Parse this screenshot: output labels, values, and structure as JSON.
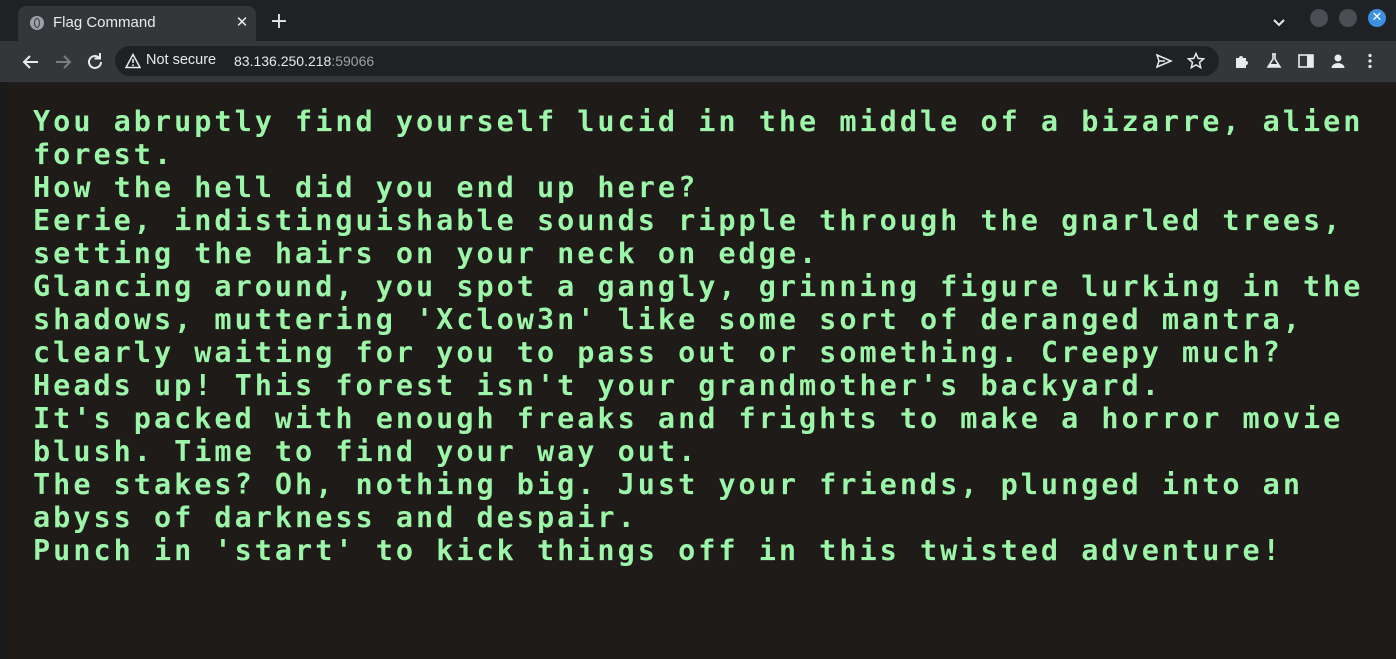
{
  "browser": {
    "tab": {
      "title": "Flag Command",
      "favicon": "globe-icon",
      "close_glyph": "✕"
    },
    "new_tab_glyph": "+",
    "window_close_glyph": "✕",
    "security_label": "Not secure",
    "url": {
      "host": "83.136.250.218",
      "port": ":59066"
    },
    "colors": {
      "tabstrip": "#202124",
      "toolbar": "#35363a",
      "page_background": "#1f1b19",
      "terminal_text": "#9cf5a8",
      "window_close": "#3d8fe0"
    }
  },
  "terminal": {
    "lines": [
      "You abruptly find yourself lucid in the middle of a bizarre, alien",
      "forest.",
      "How the hell did you end up here?",
      "Eerie, indistinguishable sounds ripple through the gnarled trees,",
      "setting the hairs on your neck on edge.",
      "Glancing around, you spot a gangly, grinning figure lurking in the",
      "shadows, muttering 'Xclow3n' like some sort of deranged mantra,",
      "clearly waiting for you to pass out or something. Creepy much?",
      "Heads up! This forest isn't your grandmother's backyard.",
      "It's packed with enough freaks and frights to make a horror movie",
      "blush. Time to find your way out.",
      "The stakes? Oh, nothing big. Just your friends, plunged into an",
      "abyss of darkness and despair.",
      "Punch in 'start' to kick things off in this twisted adventure!"
    ]
  }
}
